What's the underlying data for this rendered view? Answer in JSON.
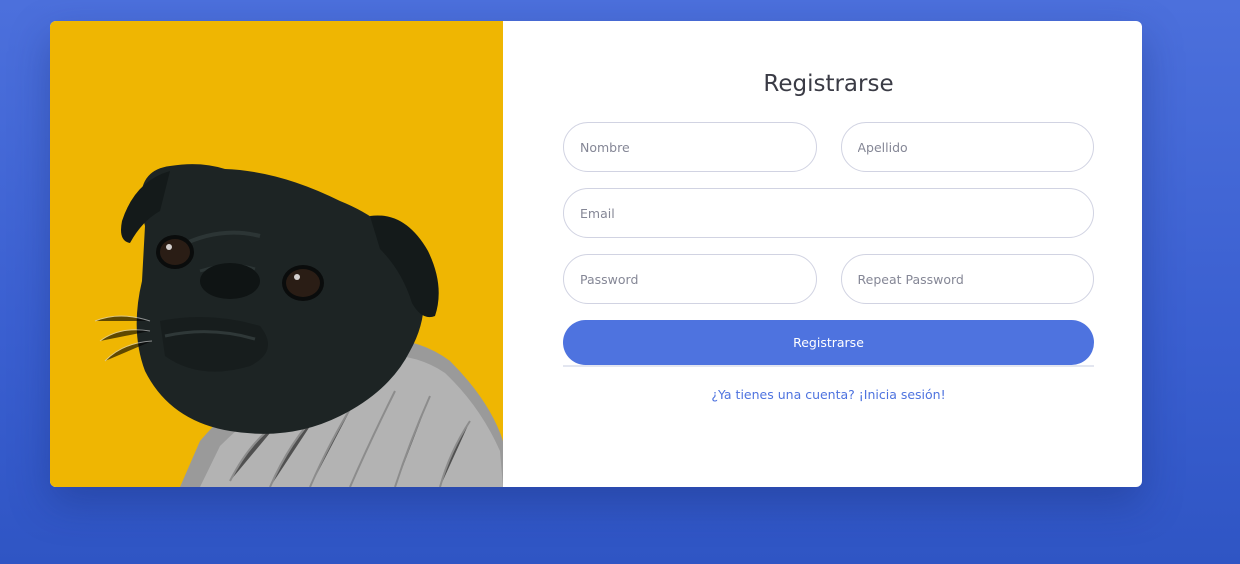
{
  "form": {
    "title": "Registrarse",
    "first_name_placeholder": "Nombre",
    "last_name_placeholder": "Apellido",
    "email_placeholder": "Email",
    "password_placeholder": "Password",
    "repeat_password_placeholder": "Repeat Password",
    "submit_label": "Registrarse",
    "login_link": "¿Ya tienes una cuenta? ¡Inicia sesión!"
  },
  "colors": {
    "background": "#4c70dc",
    "accent": "#4e73df",
    "photo_background": "#efb602"
  },
  "image": {
    "subject": "pug-dog-photo"
  }
}
